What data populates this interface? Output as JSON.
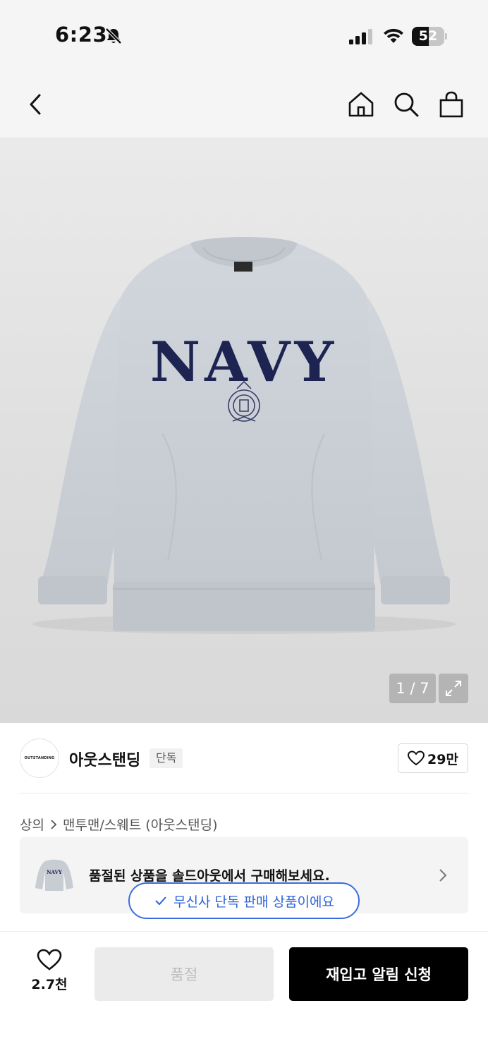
{
  "status_bar": {
    "time": "6:23",
    "battery": "52",
    "battery_level": 0.52,
    "icons": [
      "bell-off-icon",
      "signal-icon",
      "wifi-icon",
      "battery-icon"
    ]
  },
  "nav": {
    "icons": [
      "back-chevron-icon",
      "home-icon",
      "search-icon",
      "shopping-bag-icon"
    ]
  },
  "product_image": {
    "print_text": "NAVY",
    "counter": "1 / 7"
  },
  "brand": {
    "logo_text": "OUTSTANDING",
    "name": "아웃스탠딩",
    "badge": "단독",
    "likes": "29만"
  },
  "breadcrumb": {
    "category": "상의",
    "subcategory": "맨투맨/스웨트 (아웃스탠딩)"
  },
  "soldout_banner": {
    "text": "품절된 상품을 솔드아웃에서 구매해보세요."
  },
  "exclusive_pill": {
    "text": "무신사 단독 판매 상품이에요"
  },
  "bottom_bar": {
    "wish_count": "2.7천",
    "soldout_label": "품절",
    "restock_label": "재입고 알림 신청"
  },
  "colors": {
    "accent_blue": "#2d63d8",
    "primary_black": "#000000",
    "sweatshirt_grey": "#c9ced5",
    "print_navy": "#1d2452"
  }
}
